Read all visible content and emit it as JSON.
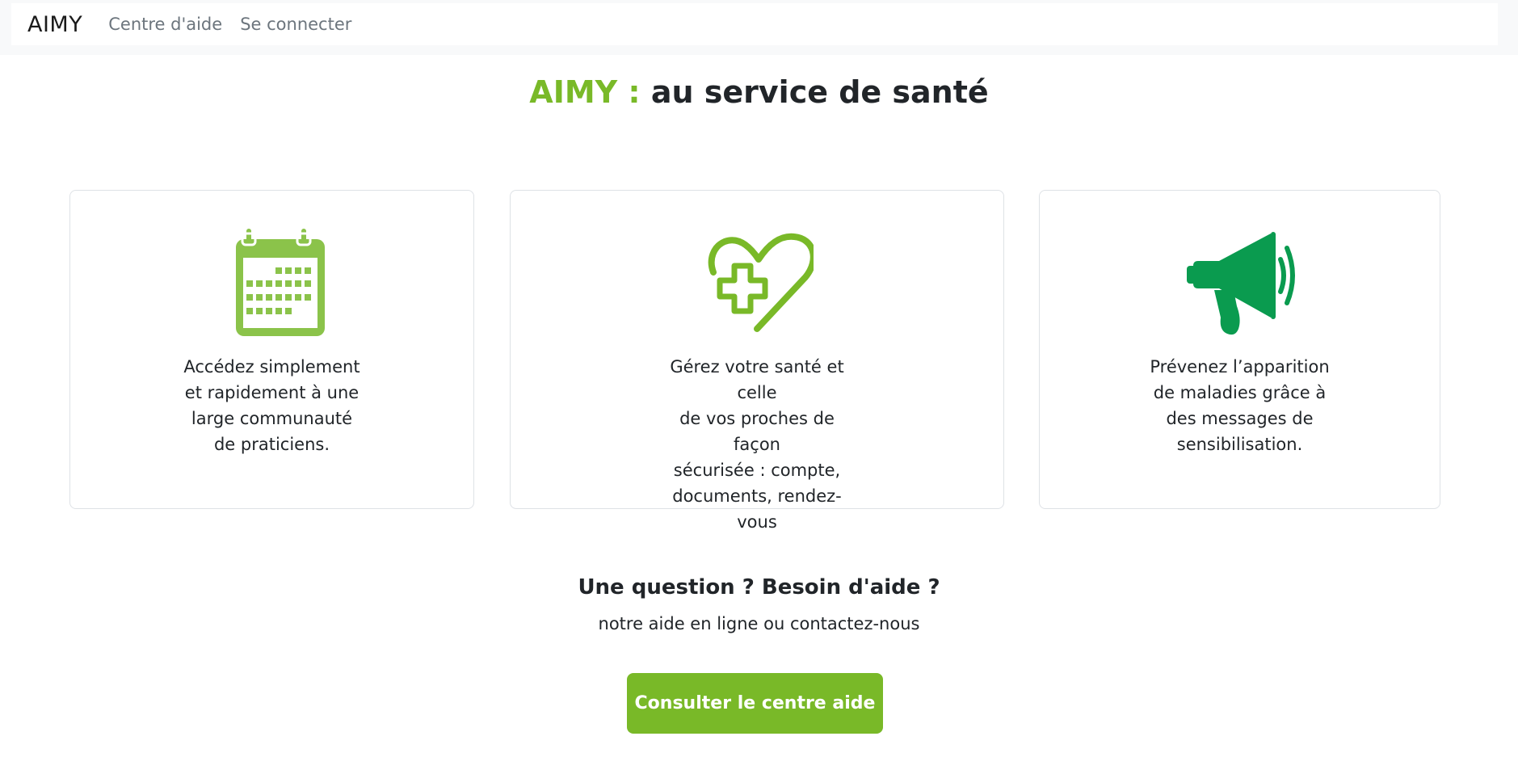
{
  "navbar": {
    "brand": "AIMY",
    "links": [
      "Centre d'aide",
      "Se connecter"
    ]
  },
  "hero": {
    "title_accent": "AIMY :",
    "title_rest": "au service de santé"
  },
  "features": [
    {
      "icon": "calendar-icon",
      "text": "Accédez simplement\net rapidement à une\nlarge communauté\nde praticiens."
    },
    {
      "icon": "heart-medical-cross-icon",
      "text": "Gérez votre santé et celle\nde vos proches de façon\nsécurisée : compte,\ndocuments, rendez-vous"
    },
    {
      "icon": "megaphone-icon",
      "text": "Prévenez l’apparition\nde maladies grâce à\ndes messages de\nsensibilisation."
    }
  ],
  "help": {
    "title": "Une question ? Besoin d'aide ?",
    "subtitle": "notre aide en ligne ou contactez-nous",
    "button_label": "Consulter le centre aide"
  },
  "colors": {
    "accent": "#79b928",
    "icon_light_green": "#8bc34a",
    "icon_dark_green": "#0a9b4f",
    "text": "#212529",
    "nav_link": "#6c757d"
  }
}
